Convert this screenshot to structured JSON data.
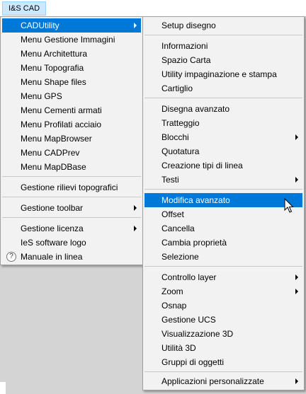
{
  "menubar": {
    "title": "I&S CAD"
  },
  "menu1": {
    "items": [
      {
        "label": "CADUtility"
      },
      {
        "label": "Menu Gestione Immagini"
      },
      {
        "label": "Menu Architettura"
      },
      {
        "label": "Menu Topografia"
      },
      {
        "label": "Menu Shape files"
      },
      {
        "label": "Menu GPS"
      },
      {
        "label": "Menu Cementi armati"
      },
      {
        "label": "Menu Profilati acciaio"
      },
      {
        "label": "Menu MapBrowser"
      },
      {
        "label": "Menu CADPrev"
      },
      {
        "label": "Menu MapDBase"
      },
      {
        "label": "Gestione rilievi topografici"
      },
      {
        "label": "Gestione toolbar"
      },
      {
        "label": "Gestione licenza"
      },
      {
        "label": "IeS software logo"
      },
      {
        "label": "Manuale in linea",
        "icon": "help-icon"
      }
    ]
  },
  "menu2": {
    "items": [
      {
        "label": "Setup disegno"
      },
      {
        "label": "Informazioni"
      },
      {
        "label": "Spazio Carta"
      },
      {
        "label": "Utility impaginazione e stampa"
      },
      {
        "label": "Cartiglio"
      },
      {
        "label": "Disegna avanzato"
      },
      {
        "label": "Tratteggio"
      },
      {
        "label": "Blocchi"
      },
      {
        "label": "Quotatura"
      },
      {
        "label": "Creazione tipi di linea"
      },
      {
        "label": "Testi"
      },
      {
        "label": "Modifica avanzato"
      },
      {
        "label": "Offset"
      },
      {
        "label": "Cancella"
      },
      {
        "label": "Cambia proprietà"
      },
      {
        "label": "Selezione"
      },
      {
        "label": "Controllo layer"
      },
      {
        "label": "Zoom"
      },
      {
        "label": "Osnap"
      },
      {
        "label": "Gestione UCS"
      },
      {
        "label": "Visualizzazione 3D"
      },
      {
        "label": "Utilità 3D"
      },
      {
        "label": "Gruppi di oggetti"
      },
      {
        "label": "Applicazioni personalizzate"
      }
    ]
  },
  "colors": {
    "highlight": "#0078d7",
    "menu_bg": "#f2f2f2",
    "menubar_active": "#cce8ff"
  },
  "icons": {
    "cursor": "mouse-pointer-icon",
    "submenu": "chevron-right-icon",
    "help": "help-icon"
  }
}
